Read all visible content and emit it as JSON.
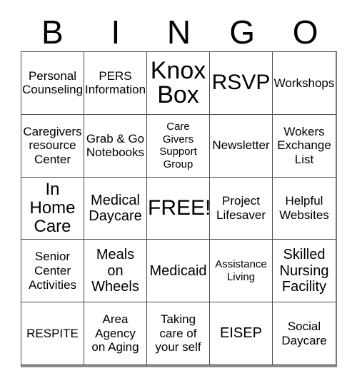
{
  "card": {
    "title": "BINGO Card",
    "header_letters": [
      "B",
      "I",
      "N",
      "G",
      "O"
    ],
    "border_color": "#4d4d4d",
    "background_color": "#ffffff",
    "text_color": "#000000",
    "free_space_label": "FREE!",
    "rows": [
      [
        {
          "text": "Personal\nCounseling",
          "size": "fs-sm"
        },
        {
          "text": "PERS\nInformation",
          "size": "fs-sm"
        },
        {
          "text": "Knox\nBox",
          "size": "fs-xxl"
        },
        {
          "text": "RSVP",
          "size": "fs-xl"
        },
        {
          "text": "Workshops",
          "size": "fs-sm"
        }
      ],
      [
        {
          "text": "Caregivers\nresource\nCenter",
          "size": "fs-sm"
        },
        {
          "text": "Grab & Go\nNotebooks",
          "size": "fs-sm"
        },
        {
          "text": "Care\nGivers\nSupport\nGroup",
          "size": "fs-xs"
        },
        {
          "text": "Newsletter",
          "size": "fs-sm"
        },
        {
          "text": "Wokers\nExchange\nList",
          "size": "fs-sm"
        }
      ],
      [
        {
          "text": "In\nHome\nCare",
          "size": "fs-lg"
        },
        {
          "text": "Medical\nDaycare",
          "size": "fs-md"
        },
        {
          "text": "FREE!",
          "size": "fs-xl"
        },
        {
          "text": "Project\nLifesaver",
          "size": "fs-sm"
        },
        {
          "text": "Helpful\nWebsites",
          "size": "fs-sm"
        }
      ],
      [
        {
          "text": "Senior\nCenter\nActivities",
          "size": "fs-sm"
        },
        {
          "text": "Meals\non\nWheels",
          "size": "fs-md"
        },
        {
          "text": "Medicaid",
          "size": "fs-md"
        },
        {
          "text": "Assistance\nLiving",
          "size": "fs-xs"
        },
        {
          "text": "Skilled\nNursing\nFacility",
          "size": "fs-md"
        }
      ],
      [
        {
          "text": "RESPITE",
          "size": "fs-sm"
        },
        {
          "text": "Area\nAgency\non Aging",
          "size": "fs-sm"
        },
        {
          "text": "Taking\ncare of\nyour self",
          "size": "fs-sm"
        },
        {
          "text": "EISEP",
          "size": "fs-md"
        },
        {
          "text": "Social\nDaycare",
          "size": "fs-sm"
        }
      ]
    ]
  }
}
